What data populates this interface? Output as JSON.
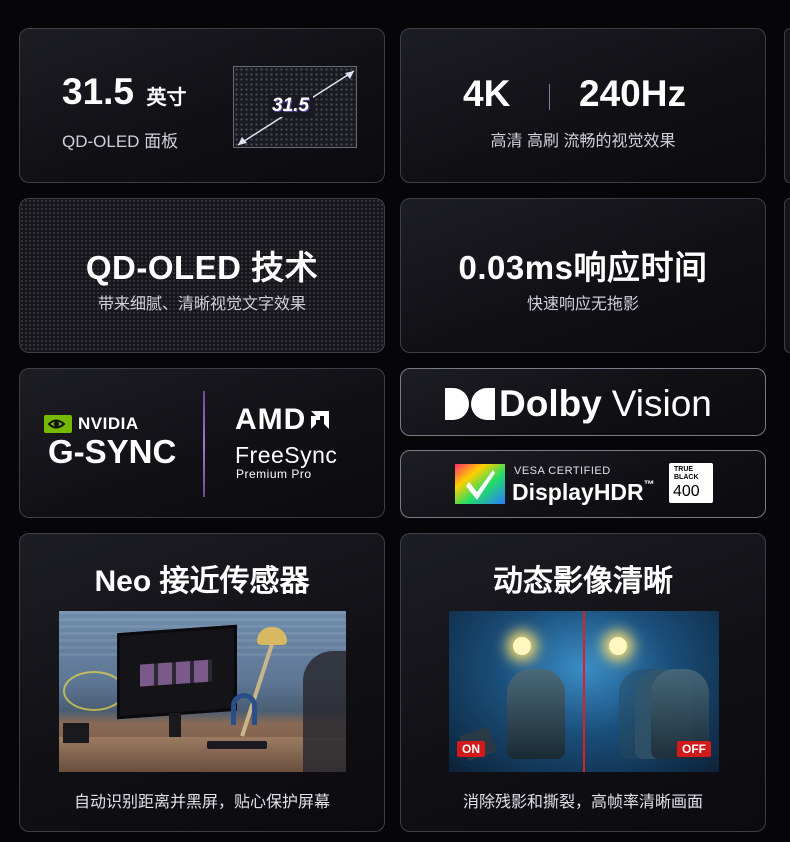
{
  "cards": {
    "panel": {
      "size_value": "31.5",
      "size_unit": "英寸",
      "panel_type": "QD-OLED 面板",
      "screen_label": "31.5"
    },
    "resolution": {
      "res": "4K",
      "refresh": "240Hz",
      "desc": "高清 高刷 流畅的视觉效果"
    },
    "tech": {
      "title": "QD-OLED 技术",
      "desc": "带来细腻、清晰视觉文字效果"
    },
    "response": {
      "title": "0.03ms响应时间",
      "desc": "快速响应无拖影"
    },
    "sync": {
      "nvidia_brand": "NVIDIA",
      "gsync": "G-SYNC",
      "amd_brand": "AMD",
      "freesync": "FreeSync",
      "freesync_tier": "Premium Pro"
    },
    "dolby": {
      "brand": "Dolby",
      "product": "Vision"
    },
    "hdr": {
      "vesa": "VESA CERTIFIED",
      "name": "DisplayHDR",
      "tm": "™",
      "tb1": "TRUE",
      "tb2": "BLACK",
      "level": "400"
    },
    "sensor": {
      "title": "Neo 接近传感器",
      "desc": "自动识别距离并黑屏，贴心保护屏幕"
    },
    "motion": {
      "title": "动态影像清晰",
      "on": "ON",
      "off": "OFF",
      "desc": "消除残影和撕裂，高帧率清晰画面"
    }
  },
  "colors": {
    "accent_purple": "#9a7ad0",
    "nvidia_green": "#76b900",
    "badge_red": "#d21a1a"
  }
}
